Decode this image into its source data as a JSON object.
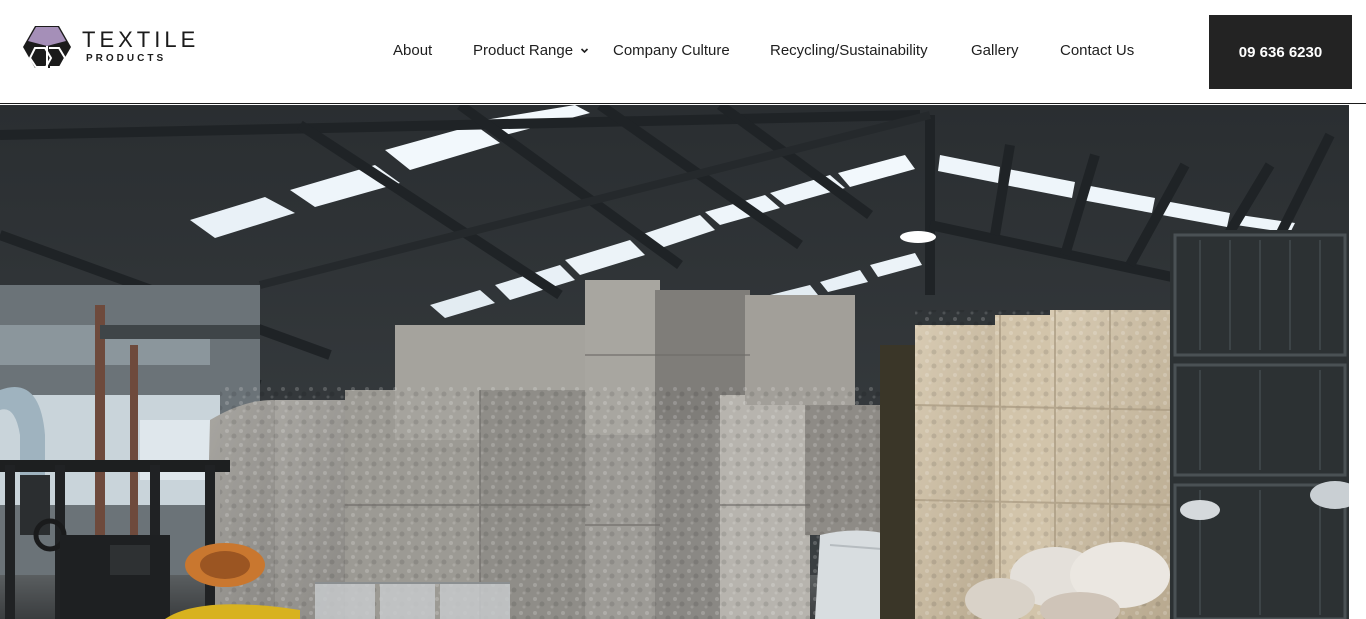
{
  "brand": {
    "name": "TEXTILE",
    "sub": "PRODUCTS",
    "colors": {
      "mark_dark": "#1b1b1b",
      "mark_accent": "#a58fb8"
    }
  },
  "nav": {
    "items": [
      {
        "label": "About"
      },
      {
        "label": "Product Range",
        "has_dropdown": true
      },
      {
        "label": "Company Culture"
      },
      {
        "label": "Recycling/Sustainability"
      },
      {
        "label": "Gallery"
      },
      {
        "label": "Contact Us"
      }
    ],
    "chevron_icon": "chevron-down-icon"
  },
  "cta": {
    "phone": "09 636 6230",
    "bg_color": "#232323"
  },
  "hero": {
    "image": "warehouse-fibre-bales-photo"
  }
}
